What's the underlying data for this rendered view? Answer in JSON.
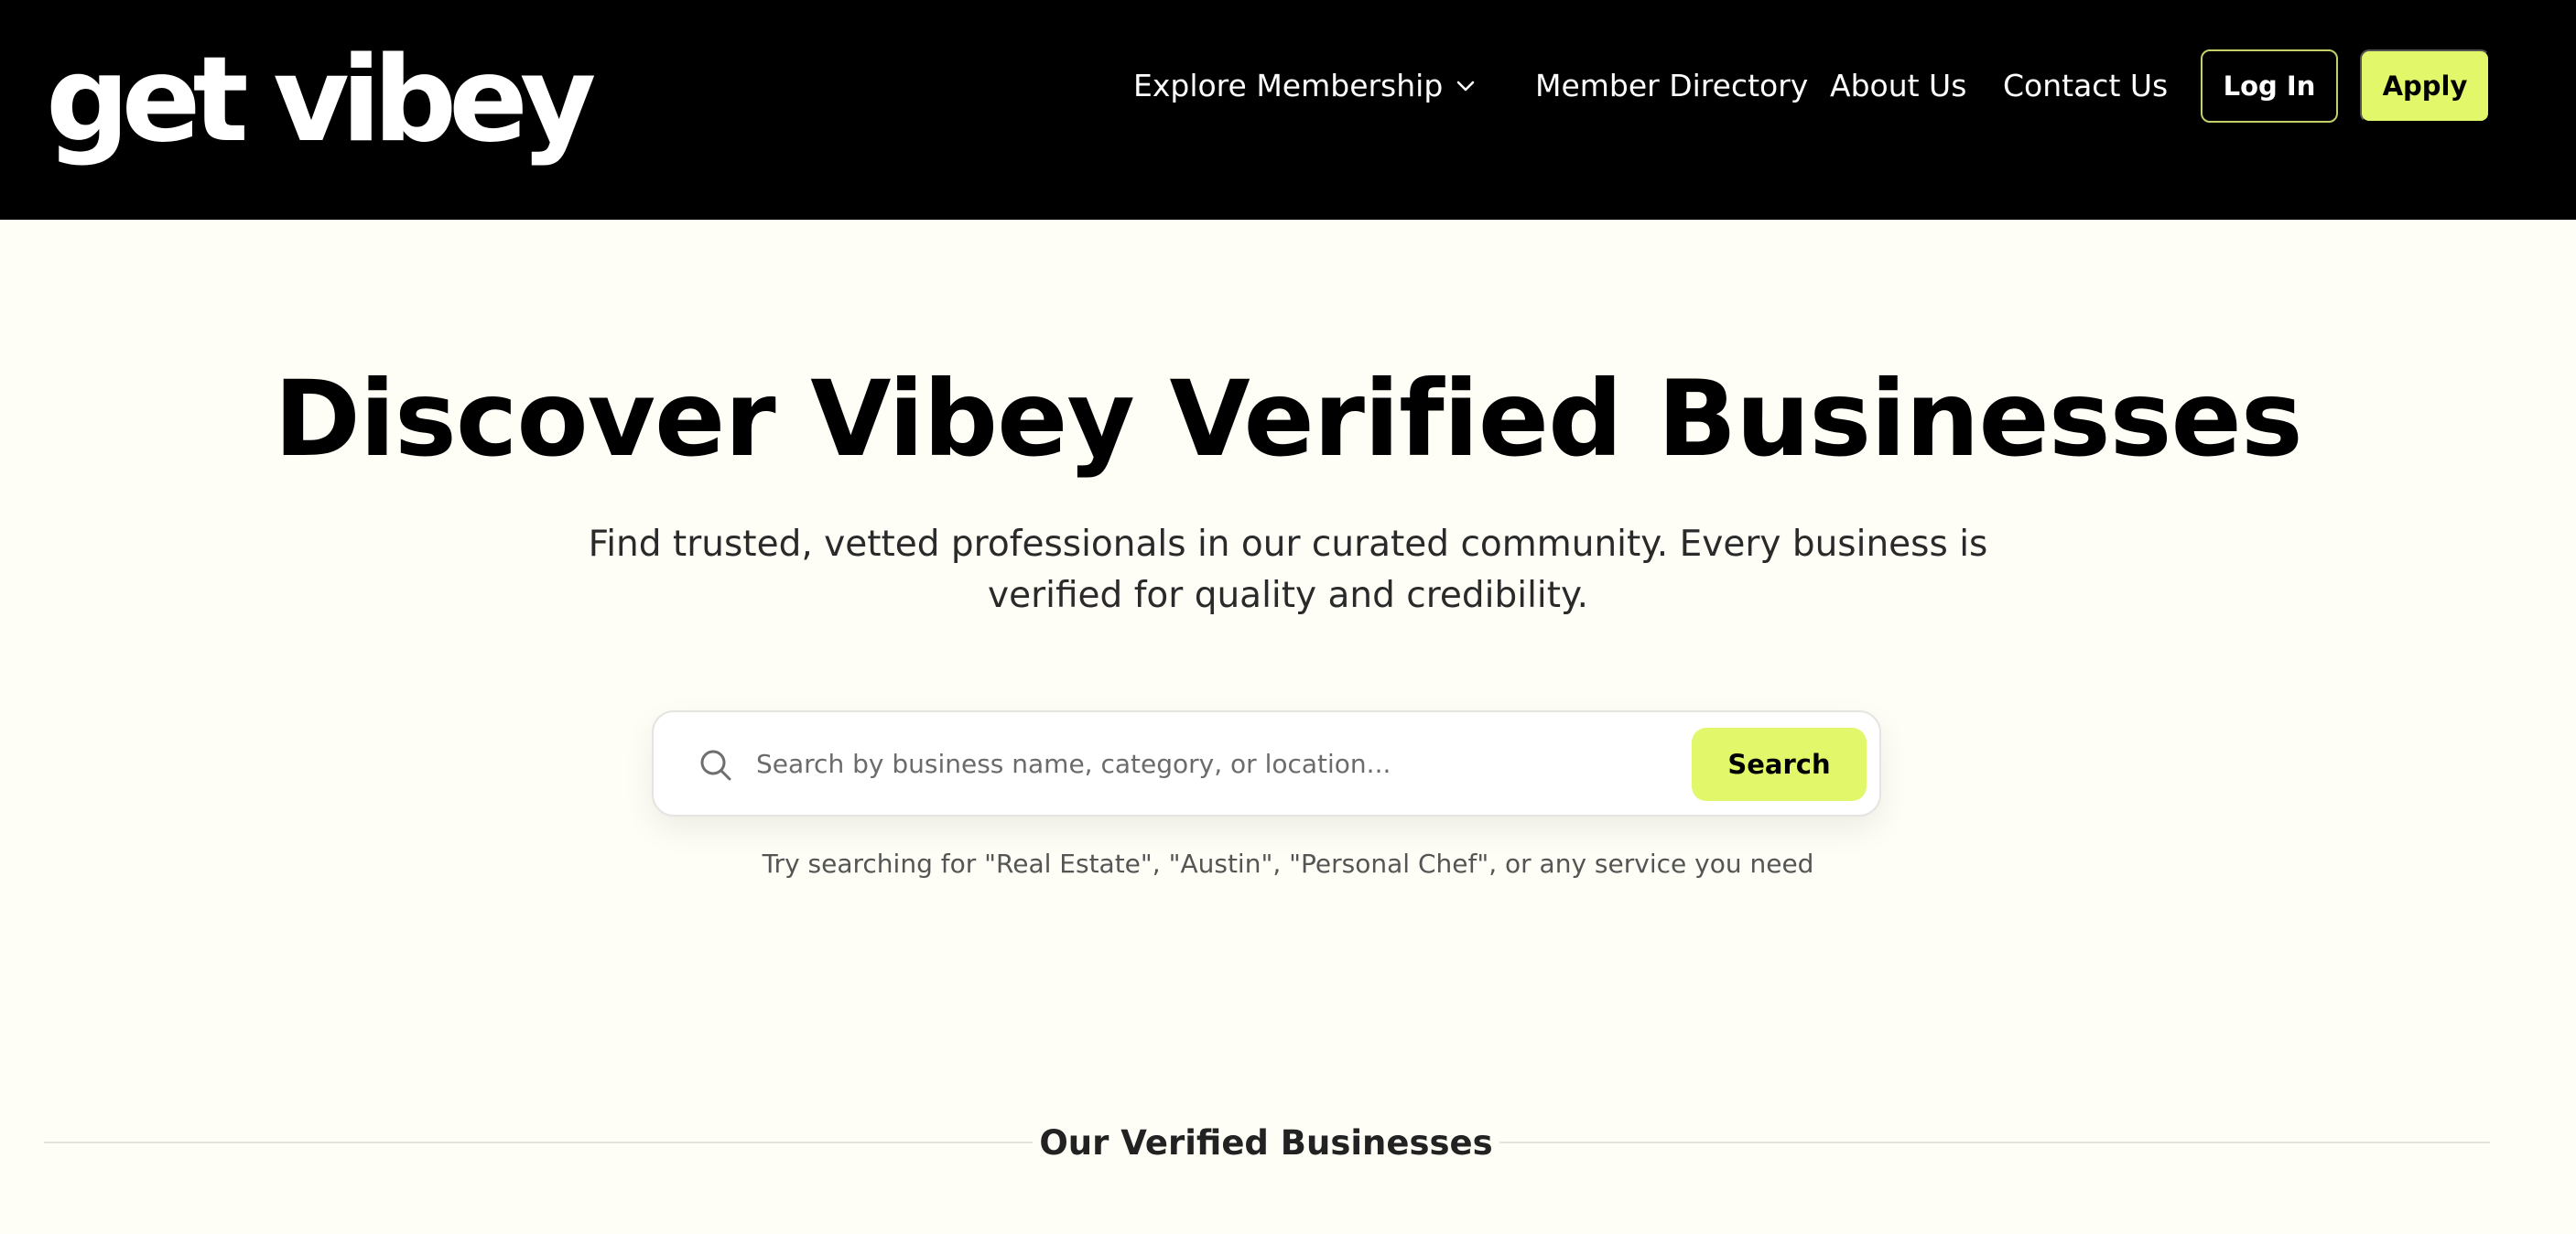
{
  "header": {
    "logo_text": "get vibey",
    "nav": {
      "explore_membership": "Explore Membership",
      "member_directory": "Member Directory",
      "about_us": "About Us",
      "contact_us": "Contact Us"
    },
    "login_label": "Log In",
    "apply_label": "Apply"
  },
  "hero": {
    "title": "Discover Vibey Verified Businesses",
    "subtitle": "Find trusted, vetted professionals in our curated community. Every business is verified for quality and credibility."
  },
  "search": {
    "placeholder": "Search by business name, category, or location...",
    "value": "",
    "button_label": "Search",
    "hint": "Try searching for \"Real Estate\", \"Austin\", \"Personal Chef\", or any service you need"
  },
  "section": {
    "title": "Our Verified Businesses"
  },
  "colors": {
    "header_bg": "#000000",
    "page_bg": "#FEFEF6",
    "accent": "#E2F86A",
    "login_border": "#C5CF6A"
  },
  "icons": {
    "dropdown": "chevron-down-icon",
    "search": "search-icon"
  }
}
